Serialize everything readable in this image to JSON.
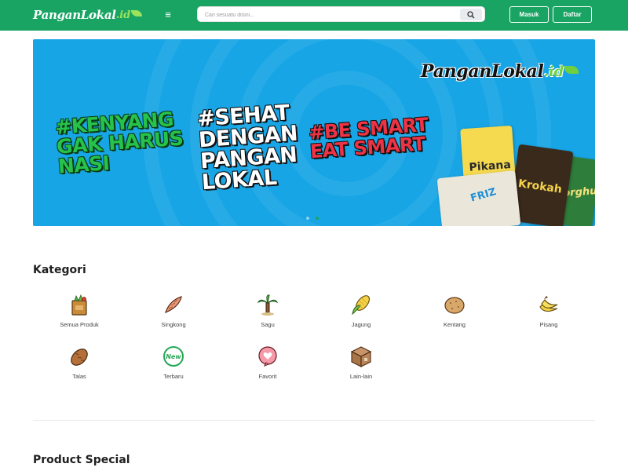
{
  "header": {
    "logo_text": "PanganLokal",
    "logo_tld": ".id",
    "menu_icon": "≡",
    "search_placeholder": "Cari sesuatu disini...",
    "login_label": "Masuk",
    "register_label": "Daftar"
  },
  "banner": {
    "tag1": [
      "#KENYANG",
      "GAK HARUS",
      "NASI"
    ],
    "tag2": [
      "#SEHAT",
      "DENGAN",
      "PANGAN",
      "LOKAL"
    ],
    "tag3": [
      "#BE SMART",
      "EAT SMART"
    ],
    "logo_text": "PanganLokal",
    "logo_tld": ".id",
    "products": [
      "Pikana",
      "FRIZ",
      "Krokah",
      "Sorghum"
    ],
    "slide_count": 2,
    "active_slide": 2
  },
  "kategori": {
    "title": "Kategori",
    "items": [
      {
        "label": "Semua Produk",
        "icon": "grocery-bag-icon"
      },
      {
        "label": "Singkong",
        "icon": "cassava-icon"
      },
      {
        "label": "Sagu",
        "icon": "palm-tree-icon"
      },
      {
        "label": "Jagung",
        "icon": "corn-icon"
      },
      {
        "label": "Kentang",
        "icon": "potato-icon"
      },
      {
        "label": "Pisang",
        "icon": "banana-icon"
      },
      {
        "label": "Talas",
        "icon": "taro-icon"
      },
      {
        "label": "Terbaru",
        "icon": "new-badge-icon"
      },
      {
        "label": "Favorit",
        "icon": "heart-bubble-icon"
      },
      {
        "label": "Lain-lain",
        "icon": "box-icon"
      }
    ]
  },
  "product_special": {
    "title": "Product Special"
  },
  "colors": {
    "brand_green": "#19a463",
    "banner_blue": "#17a5e6"
  }
}
